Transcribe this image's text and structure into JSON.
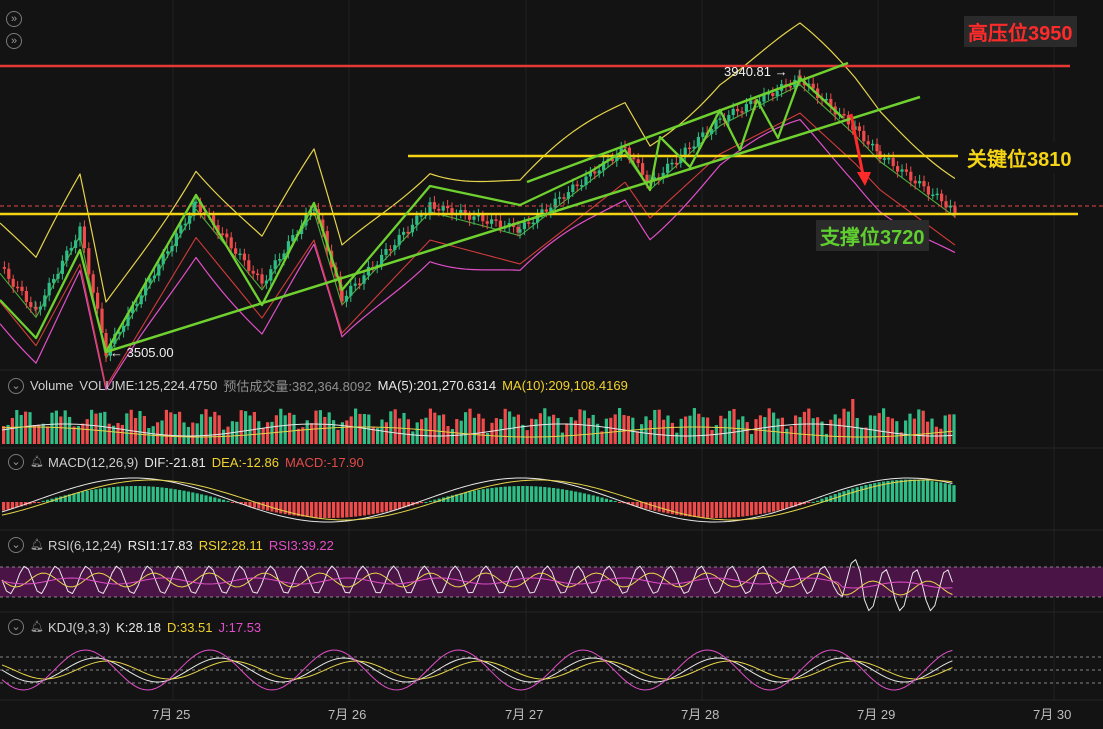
{
  "levels": {
    "high": {
      "label": "高压位3950",
      "value": 3950,
      "color": "#e53935"
    },
    "key": {
      "label": "关键位3810",
      "value": 3810,
      "color": "#f5d415"
    },
    "support": {
      "label": "支撑位3720",
      "value": 3720,
      "color": "#f5d415",
      "text_color": "#5fcf2f"
    }
  },
  "annotations": {
    "high_price": "3940.81 →",
    "low_price": "← 3505.00"
  },
  "panels": {
    "volume": {
      "name": "Volume",
      "volume": "VOLUME:125,224.4750",
      "est": "预估成交量:382,364.8092",
      "ma5": "MA(5):201,270.6314",
      "ma10": "MA(10):209,108.4169"
    },
    "macd": {
      "name": "MACD(12,26,9)",
      "dif": "DIF:-21.81",
      "dea": "DEA:-12.86",
      "macd": "MACD:-17.90"
    },
    "rsi": {
      "name": "RSI(6,12,24)",
      "rsi1": "RSI1:17.83",
      "rsi2": "RSI2:28.11",
      "rsi3": "RSI3:39.22"
    },
    "kdj": {
      "name": "KDJ(9,3,3)",
      "k": "K:28.18",
      "d": "D:33.51",
      "j": "J:17.53"
    }
  },
  "x_labels": [
    "7月 25",
    "7月 26",
    "7月 27",
    "7月 28",
    "7月 29",
    "7月 30"
  ],
  "colors": {
    "up": "#2ebd85",
    "down": "#f04b4b",
    "trend": "#6fd12f",
    "ma_yellow": "#e6d44a",
    "ma_red": "#d23b3b",
    "boll_green": "#4cae3a",
    "boll_pink": "#e04fc8",
    "arrow": "#ff2a2a"
  },
  "chart_data": {
    "type": "candlestick",
    "x": [
      "7月 25",
      "7月 26",
      "7月 27",
      "7月 28",
      "7月 29",
      "7月 30"
    ],
    "price_extremes": {
      "low": 3505.0,
      "high": 3940.81
    },
    "horizontal_levels": [
      3950,
      3810,
      3720
    ],
    "indicators": {
      "volume": 125224.475,
      "estimated_volume": 382364.8092,
      "ma5": 201270.6314,
      "ma10": 209108.4169,
      "dif": -21.81,
      "dea": -12.86,
      "macd": -17.9,
      "rsi1": 17.83,
      "rsi2": 28.11,
      "rsi3": 39.22,
      "k": 28.18,
      "d": 33.51,
      "j": 17.53
    }
  }
}
